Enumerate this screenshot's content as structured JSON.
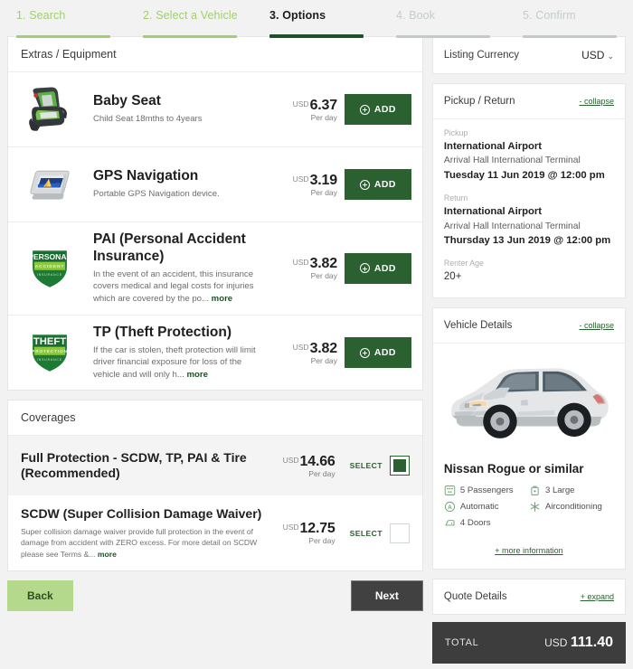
{
  "steps": [
    {
      "label": "1. Search",
      "state": "done"
    },
    {
      "label": "2. Select a Vehicle",
      "state": "done"
    },
    {
      "label": "3. Options",
      "state": "current"
    },
    {
      "label": "4. Book",
      "state": "future"
    },
    {
      "label": "5. Confirm",
      "state": "future"
    }
  ],
  "extras": {
    "header": "Extras / Equipment",
    "items": [
      {
        "icon": "baby-seat-image",
        "title": "Baby Seat",
        "desc": "Child Seat 18mths to 4years",
        "more": "",
        "currency": "USD",
        "amount": "6.37",
        "per": "Per day",
        "button": "ADD"
      },
      {
        "icon": "gps-device-image",
        "title": "GPS Navigation",
        "desc": "Portable GPS Navigation device.",
        "more": "",
        "currency": "USD",
        "amount": "3.19",
        "per": "Per day",
        "button": "ADD"
      },
      {
        "icon": "personal-accident-shield-badge",
        "title": "PAI (Personal Accident Insurance)",
        "desc": "In the event of an accident, this insurance covers medical and legal costs for injuries which are covered by the po...",
        "more": "more",
        "currency": "USD",
        "amount": "3.82",
        "per": "Per day",
        "button": "ADD"
      },
      {
        "icon": "theft-protection-shield-badge",
        "title": "TP (Theft Protection)",
        "desc": "If the car is stolen, theft protection will limit driver financial exposure for loss of the vehicle and will only h...",
        "more": "more",
        "currency": "USD",
        "amount": "3.82",
        "per": "Per day",
        "button": "ADD"
      }
    ]
  },
  "coverages": {
    "header": "Coverages",
    "items": [
      {
        "title": "Full Protection - SCDW, TP, PAI & Tire (Recommended)",
        "desc": "",
        "more": "",
        "currency": "USD",
        "amount": "14.66",
        "per": "Per day",
        "select_label": "SELECT",
        "selected": true
      },
      {
        "title": "SCDW (Super Collision Damage Waiver)",
        "desc": "Super collision damage waiver provide full protection in the event of damage from accident with ZERO excess. For more detail on SCDW please see Terms &...",
        "more": "more",
        "currency": "USD",
        "amount": "12.75",
        "per": "Per day",
        "select_label": "SELECT",
        "selected": false
      }
    ]
  },
  "nav": {
    "back": "Back",
    "next": "Next"
  },
  "sidebar": {
    "currency": {
      "label": "Listing Currency",
      "value": "USD"
    },
    "pickup_return": {
      "title": "Pickup / Return",
      "collapse": "- collapse",
      "pickup_label": "Pickup",
      "pickup_place": "International Airport",
      "pickup_terminal": "Arrival Hall International Terminal",
      "pickup_datetime": "Tuesday 11 Jun 2019 @ 12:00 pm",
      "return_label": "Return",
      "return_place": "International Airport",
      "return_terminal": "Arrival Hall International Terminal",
      "return_datetime": "Thursday 13 Jun 2019 @ 12:00 pm",
      "age_label": "Renter Age",
      "age_value": "20+"
    },
    "vehicle": {
      "title": "Vehicle Details",
      "collapse": "- collapse",
      "name": "Nissan Rogue or similar",
      "specs": [
        {
          "icon": "passengers-icon",
          "label": "5 Passengers"
        },
        {
          "icon": "luggage-icon",
          "label": "3 Large"
        },
        {
          "icon": "automatic-transmission-icon",
          "label": "Automatic"
        },
        {
          "icon": "airconditioning-icon",
          "label": "Airconditioning"
        },
        {
          "icon": "doors-icon",
          "label": "4 Doors"
        }
      ],
      "more_information": "+ more information"
    },
    "quote": {
      "title": "Quote Details",
      "expand": "+ expand"
    },
    "total": {
      "label": "TOTAL",
      "currency": "USD",
      "amount": "111.40"
    }
  },
  "colors": {
    "brand_green": "#2b6130",
    "light_green": "#a3ce6e",
    "dark_bar": "#3d3d3d",
    "back_button": "#b5d98c",
    "next_button": "#414141"
  }
}
